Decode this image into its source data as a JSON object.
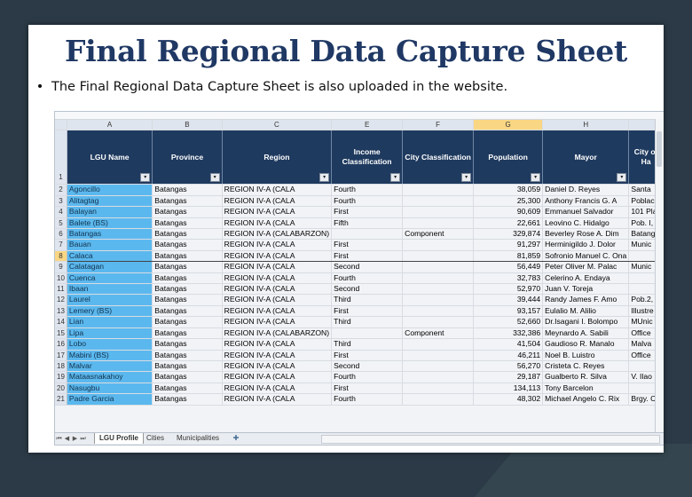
{
  "slide": {
    "title": "Final Regional Data Capture Sheet",
    "bullet_char": "•",
    "bullet": "The Final Regional Data Capture Sheet is also uploaded in the website."
  },
  "sheet": {
    "column_letters": [
      "A",
      "B",
      "C",
      "E",
      "F",
      "G",
      "H"
    ],
    "selected_column": "G",
    "header_row_number": "1",
    "headers": [
      "LGU Name",
      "Province",
      "Region",
      "Income Classification",
      "City Classification",
      "Population",
      "Mayor",
      "City of Ha"
    ],
    "filter_glyph": "▾",
    "selected_row": "8",
    "rows": [
      {
        "n": "2",
        "lgu": "Agoncillo",
        "province": "Batangas",
        "region": "REGION IV-A (CALA",
        "income": "Fourth",
        "city": "",
        "pop": "38,059",
        "mayor": "Daniel D. Reyes",
        "hall": "Santa"
      },
      {
        "n": "3",
        "lgu": "Alitagtag",
        "province": "Batangas",
        "region": "REGION IV-A (CALA",
        "income": "Fourth",
        "city": "",
        "pop": "25,300",
        "mayor": "Anthony Francis G. A",
        "hall": "Poblac"
      },
      {
        "n": "4",
        "lgu": "Balayan",
        "province": "Batangas",
        "region": "REGION IV-A (CALA",
        "income": "First",
        "city": "",
        "pop": "90,609",
        "mayor": "Emmanuel Salvador",
        "hall": "101 Pla"
      },
      {
        "n": "5",
        "lgu": "Balete (BS)",
        "province": "Batangas",
        "region": "REGION IV-A (CALA",
        "income": "Fifth",
        "city": "",
        "pop": "22,661",
        "mayor": "Leovino C. Hidalgo",
        "hall": "Pob. I,"
      },
      {
        "n": "6",
        "lgu": "Batangas",
        "province": "Batangas",
        "region": "REGION IV-A (CALABARZON)",
        "income": "",
        "city": "Component",
        "pop": "329,874",
        "mayor": "Beverley Rose A. Dim",
        "hall": "Batang"
      },
      {
        "n": "7",
        "lgu": "Bauan",
        "province": "Batangas",
        "region": "REGION IV-A (CALA",
        "income": "First",
        "city": "",
        "pop": "91,297",
        "mayor": "Herminigildo J. Dolor",
        "hall": "Munic"
      },
      {
        "n": "8",
        "lgu": "Calaca",
        "province": "Batangas",
        "region": "REGION IV-A (CALA",
        "income": "First",
        "city": "",
        "pop": "81,859",
        "mayor": "Sofronio Manuel C. Ona",
        "hall": ""
      },
      {
        "n": "9",
        "lgu": "Calatagan",
        "province": "Batangas",
        "region": "REGION IV-A (CALA",
        "income": "Second",
        "city": "",
        "pop": "56,449",
        "mayor": "Peter Oliver M. Palac",
        "hall": "Munic"
      },
      {
        "n": "10",
        "lgu": "Cuenca",
        "province": "Batangas",
        "region": "REGION IV-A (CALA",
        "income": "Fourth",
        "city": "",
        "pop": "32,783",
        "mayor": "Celerino A. Endaya",
        "hall": ""
      },
      {
        "n": "11",
        "lgu": "Ibaan",
        "province": "Batangas",
        "region": "REGION IV-A (CALA",
        "income": "Second",
        "city": "",
        "pop": "52,970",
        "mayor": "Juan V. Toreja",
        "hall": ""
      },
      {
        "n": "12",
        "lgu": "Laurel",
        "province": "Batangas",
        "region": "REGION IV-A (CALA",
        "income": "Third",
        "city": "",
        "pop": "39,444",
        "mayor": "Randy James F. Amo",
        "hall": "Pob.2,"
      },
      {
        "n": "13",
        "lgu": "Lemery (BS)",
        "province": "Batangas",
        "region": "REGION IV-A (CALA",
        "income": "First",
        "city": "",
        "pop": "93,157",
        "mayor": "Eulalio M. Alilio",
        "hall": "Illustre"
      },
      {
        "n": "14",
        "lgu": "Lian",
        "province": "Batangas",
        "region": "REGION IV-A (CALA",
        "income": "Third",
        "city": "",
        "pop": "52,660",
        "mayor": "Dr.Isagani I. Bolompo",
        "hall": "MUnic"
      },
      {
        "n": "15",
        "lgu": "Lipa",
        "province": "Batangas",
        "region": "REGION IV-A (CALABARZON)",
        "income": "",
        "city": "Component",
        "pop": "332,386",
        "mayor": "Meynardo A. Sabili",
        "hall": "Office"
      },
      {
        "n": "16",
        "lgu": "Lobo",
        "province": "Batangas",
        "region": "REGION IV-A (CALA",
        "income": "Third",
        "city": "",
        "pop": "41,504",
        "mayor": "Gaudioso R. Manalo",
        "hall": "Malva"
      },
      {
        "n": "17",
        "lgu": "Mabini (BS)",
        "province": "Batangas",
        "region": "REGION IV-A (CALA",
        "income": "First",
        "city": "",
        "pop": "46,211",
        "mayor": "Noel B. Luistro",
        "hall": "Office"
      },
      {
        "n": "18",
        "lgu": "Malvar",
        "province": "Batangas",
        "region": "REGION IV-A (CALA",
        "income": "Second",
        "city": "",
        "pop": "56,270",
        "mayor": "Cristeta C. Reyes",
        "hall": ""
      },
      {
        "n": "19",
        "lgu": "Mataasnakahoy",
        "province": "Batangas",
        "region": "REGION IV-A (CALA",
        "income": "Fourth",
        "city": "",
        "pop": "29,187",
        "mayor": "Gualberto R. Silva",
        "hall": "V. Ilao"
      },
      {
        "n": "20",
        "lgu": "Nasugbu",
        "province": "Batangas",
        "region": "REGION IV-A (CALA",
        "income": "First",
        "city": "",
        "pop": "134,113",
        "mayor": "Tony Barcelon",
        "hall": ""
      },
      {
        "n": "21",
        "lgu": "Padre Garcia",
        "province": "Batangas",
        "region": "REGION IV-A (CALA",
        "income": "Fourth",
        "city": "",
        "pop": "48,302",
        "mayor": "Michael Angelo C. Rix",
        "hall": "Brgy. C"
      }
    ],
    "tab_nav": [
      "⏮",
      "◀",
      "▶",
      "⏭"
    ],
    "tabs": [
      "LGU Profile",
      "Cities",
      "Municipalities"
    ],
    "active_tab": "LGU Profile",
    "new_sheet_glyph": "✚"
  },
  "colors": {
    "title": "#1f3864",
    "header_fill": "#1f3a5f",
    "lgu_fill": "#5bb8ee",
    "selected_header": "#f9d683"
  }
}
